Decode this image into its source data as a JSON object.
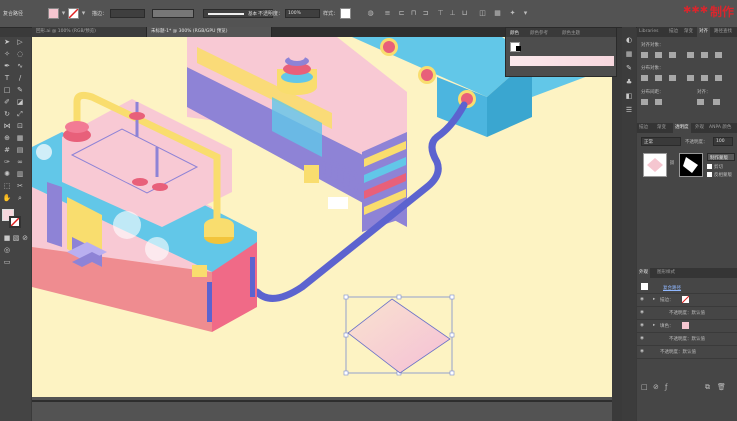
{
  "control_bar": {
    "selection_label": "复合路径",
    "stroke_label": "描边：",
    "stroke_profile_label": "基本",
    "opacity_label": "不透明度：",
    "opacity_value": "100%",
    "style_label": "样式："
  },
  "watermark": "制作",
  "tabs": [
    {
      "label": "回形.ai @ 100% (RGB/预览)",
      "active": false
    },
    {
      "label": "未标题-1* @ 300% (RGB/GPU 预览)",
      "active": true
    }
  ],
  "color_panel": {
    "tabs": [
      "颜色",
      "颜色参考",
      "颜色主题"
    ]
  },
  "right_panels": {
    "top_tabs": [
      "Libraries",
      "描边",
      "渐变",
      "对齐",
      "路径查找"
    ],
    "align_objects_label": "对齐对象：",
    "distribute_objects_label": "分布对象：",
    "distribute_spacing_label": "分布间距：",
    "align_to_label": "对齐：",
    "transparency_tabs": [
      "描边",
      "渐变",
      "透明度",
      "外观",
      "ANPA 颜色"
    ],
    "blend_mode": "正常",
    "opacity_label": "不透明度：",
    "opacity_value": "100",
    "make_mask_button": "制作蒙版",
    "clip_label": "剪切",
    "invert_mask_label": "反相蒙版",
    "appearance_tabs": [
      "外观",
      "图形样式"
    ],
    "appearance_title": "复合路径",
    "appearance_rows": [
      {
        "label": "描边：",
        "kind": "stroke"
      },
      {
        "label": "不透明度：默认值",
        "kind": "opacity"
      },
      {
        "label": "填色：",
        "kind": "fill"
      },
      {
        "label": "不透明度：默认值",
        "kind": "opacity"
      },
      {
        "label": "不透明度：默认值",
        "kind": "opacity"
      }
    ]
  },
  "colors": {
    "canvas_bg": "#fdf3c3",
    "pink": "#f8c9d4",
    "cyan": "#62c7e8",
    "blue_pipe": "#5c63cf",
    "yellow": "#f9dd6e",
    "purple": "#8e83d6",
    "red": "#e8607a"
  }
}
